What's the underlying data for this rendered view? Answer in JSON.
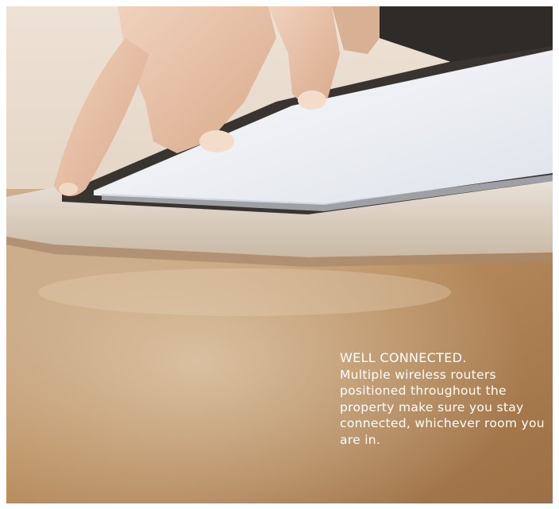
{
  "caption": {
    "headline": "WELL CONNECTED.",
    "body": "Multiple wireless routers positioned throughout the property make sure you stay connected, whichever room you are in."
  },
  "colors": {
    "table_wood": "#b78c5e",
    "tablet_bezel": "#e9e2d8",
    "tablet_screen": "#f2f3f6",
    "skin": "#e8c2a6",
    "caption_text": "#ffffff"
  },
  "photo": {
    "subject": "hand-touching-tablet-on-wooden-table"
  }
}
